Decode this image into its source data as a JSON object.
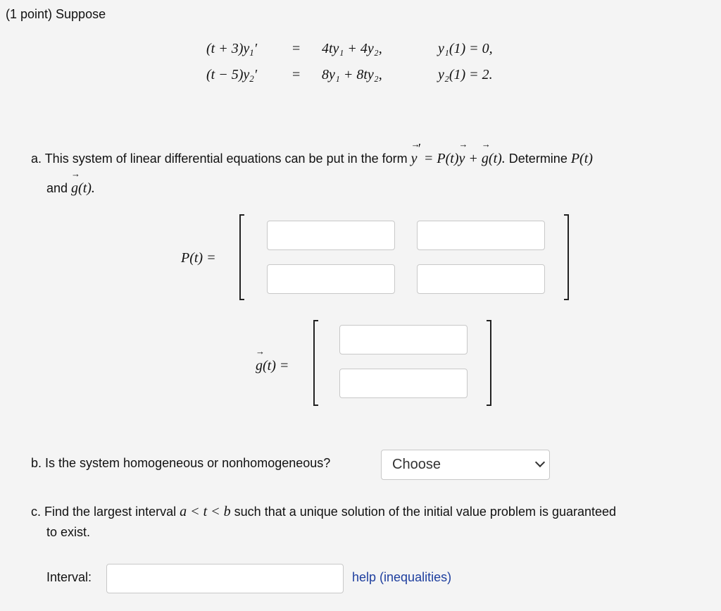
{
  "header": {
    "points": "(1 point) Suppose"
  },
  "system": {
    "rows": [
      {
        "lhs_pre": "(t + 3)y",
        "lhs_sub": "1",
        "lhs_prime": "′",
        "eq": "=",
        "rhs": "4ty₁ + 4y₂,",
        "ic": "y₁(1) = 0,"
      },
      {
        "lhs_pre": "(t − 5)y",
        "lhs_sub": "2",
        "lhs_prime": "′",
        "eq": "=",
        "rhs": "8y₁ + 8ty₂,",
        "ic": "y₂(1) = 2."
      }
    ]
  },
  "part_a": {
    "text": "a. This system of linear differential equations can be put in the form",
    "form_y": "y",
    "form_prime": "′",
    "form_rest1": " = P(t)",
    "form_y2": "y",
    "form_plus": " + ",
    "form_g": "g",
    "form_rest2": "(t).",
    "determine": " Determine ",
    "determine_p": "P(t)",
    "and": "and ",
    "and_g": "g",
    "and_rest": "(t).",
    "p_label": "P(t) =",
    "g_label_g": "g",
    "g_label_rest": "(t) =",
    "p_inputs": [
      "",
      "",
      "",
      ""
    ],
    "g_inputs": [
      "",
      ""
    ]
  },
  "part_b": {
    "text": "b. Is the system homogeneous or nonhomogeneous?",
    "select_value": "Choose"
  },
  "part_c": {
    "text_pre": "c. Find the largest interval ",
    "interval_math": "a < t < b",
    "text_post": " such that a unique solution of the initial value problem is guaranteed",
    "text_line2": "to exist.",
    "interval_label": "Interval:",
    "interval_value": "",
    "help_link": "help (inequalities)"
  },
  "colors": {
    "background": "#f4f4f4",
    "link": "#1d3e9e"
  }
}
